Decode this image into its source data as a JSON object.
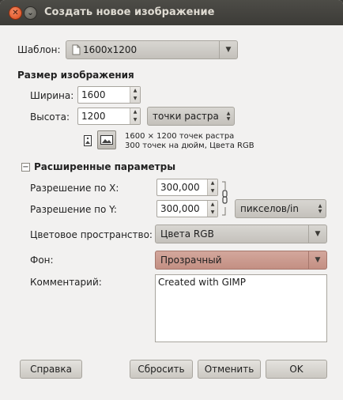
{
  "window": {
    "title": "Создать новое изображение",
    "close_icon": "close-icon",
    "minimize_icon": "minimize-icon"
  },
  "template": {
    "label": "Шаблон:",
    "value": "1600x1200",
    "icon": "document-icon"
  },
  "image_size": {
    "heading": "Размер изображения",
    "width_label": "Ширина:",
    "width_value": "1600",
    "height_label": "Высота:",
    "height_value": "1200",
    "unit_value": "точки растра",
    "info_line1": "1600 × 1200 точек растра",
    "info_line2": "300 точек на дюйм, Цвета RGB",
    "portrait_icon": "portrait-icon",
    "landscape_icon": "landscape-icon"
  },
  "advanced": {
    "toggle": "−",
    "heading": "Расширенные параметры",
    "xres_label": "Разрешение по X:",
    "xres_value": "300,000",
    "yres_label": "Разрешение по Y:",
    "yres_value": "300,000",
    "res_unit": "пикселов/in",
    "chain_icon": "chain-link-icon",
    "colorspace_label": "Цветовое пространство:",
    "colorspace_value": "Цвета RGB",
    "fill_label": "Фон:",
    "fill_value": "Прозрачный",
    "comment_label": "Комментарий:",
    "comment_value": "Created with GIMP"
  },
  "buttons": {
    "help": "Справка",
    "reset": "Сбросить",
    "cancel": "Отменить",
    "ok": "OK"
  }
}
